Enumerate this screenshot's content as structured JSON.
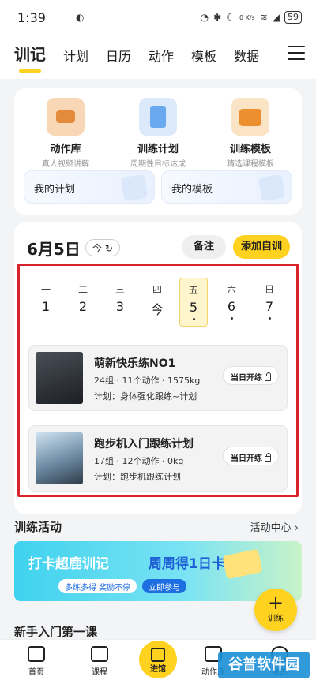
{
  "status_bar": {
    "time": "1:39",
    "net_speed": "0 K/s",
    "battery": "59"
  },
  "top_nav": {
    "tabs": [
      "训记",
      "计划",
      "日历",
      "动作",
      "模板",
      "数据"
    ]
  },
  "quick_links": [
    {
      "title": "动作库",
      "subtitle": "真人视频讲解"
    },
    {
      "title": "训练计划",
      "subtitle": "周期性目标达成"
    },
    {
      "title": "训练模板",
      "subtitle": "精选课程模板"
    }
  ],
  "mini_links": {
    "my_plan": "我的计划",
    "my_template": "我的模板"
  },
  "schedule": {
    "date": "6月5日",
    "today_label": "今",
    "note_button": "备注",
    "add_button": "添加自训",
    "week": [
      {
        "weekday": "一",
        "day": "1",
        "has_dot": false
      },
      {
        "weekday": "二",
        "day": "2",
        "has_dot": false
      },
      {
        "weekday": "三",
        "day": "3",
        "has_dot": false
      },
      {
        "weekday": "四",
        "day": "今",
        "has_dot": false
      },
      {
        "weekday": "五",
        "day": "5",
        "has_dot": true
      },
      {
        "weekday": "六",
        "day": "6",
        "has_dot": true
      },
      {
        "weekday": "日",
        "day": "7",
        "has_dot": true
      }
    ],
    "selected_index": 4,
    "plans": [
      {
        "name": "萌新快乐练NO1",
        "meta": "24组 · 11个动作 · 1575kg",
        "plan": "计划：身体强化跟练~计划",
        "action": "当日开练"
      },
      {
        "name": "跑步机入门跟练计划",
        "meta": "17组 · 12个动作 · 0kg",
        "plan": "计划：跑步机跟练计划",
        "action": "当日开练"
      }
    ]
  },
  "activity": {
    "title": "训练活动",
    "link": "活动中心 ›",
    "banner_left": "打卡超鹿训记",
    "banner_right": "周周得1日卡",
    "banner_tag": "多练多得 奖励不停",
    "banner_cta": "立即参与"
  },
  "fab": {
    "plus": "+",
    "label": "训练"
  },
  "newcomer_title": "新手入门第一课",
  "bottom_nav": [
    {
      "label": "首页"
    },
    {
      "label": "课程"
    },
    {
      "label": "进馆"
    },
    {
      "label": "动作库"
    },
    {
      "label": "我的"
    }
  ],
  "watermark": "谷普软件园",
  "colors": {
    "accent": "#ffd21f",
    "highlight_box": "#d8232a"
  }
}
